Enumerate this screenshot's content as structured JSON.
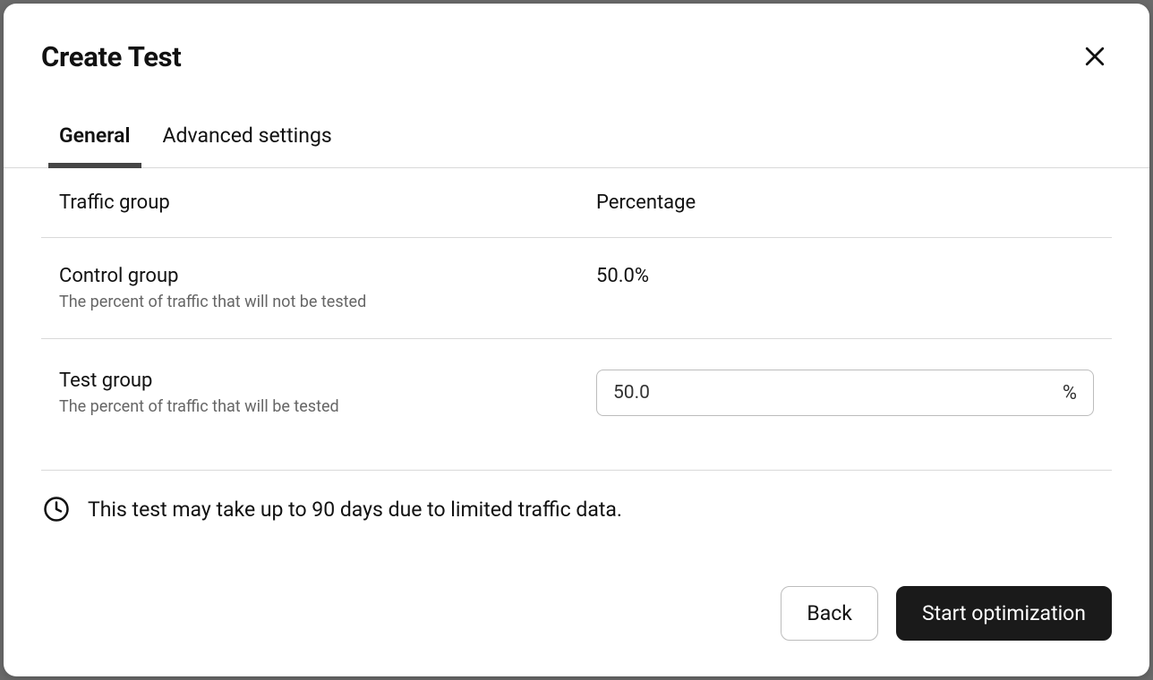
{
  "modal": {
    "title": "Create Test"
  },
  "tabs": {
    "general": "General",
    "advanced": "Advanced settings"
  },
  "table": {
    "header_group": "Traffic group",
    "header_percentage": "Percentage"
  },
  "rows": {
    "control": {
      "title": "Control group",
      "desc": "The percent of traffic that will not be tested",
      "value": "50.0%"
    },
    "test": {
      "title": "Test group",
      "desc": "The percent of traffic that will be tested",
      "input_value": "50.0",
      "suffix": "%"
    }
  },
  "notice": {
    "text": "This test may take up to 90 days due to limited traffic data."
  },
  "footer": {
    "back": "Back",
    "start": "Start optimization"
  }
}
